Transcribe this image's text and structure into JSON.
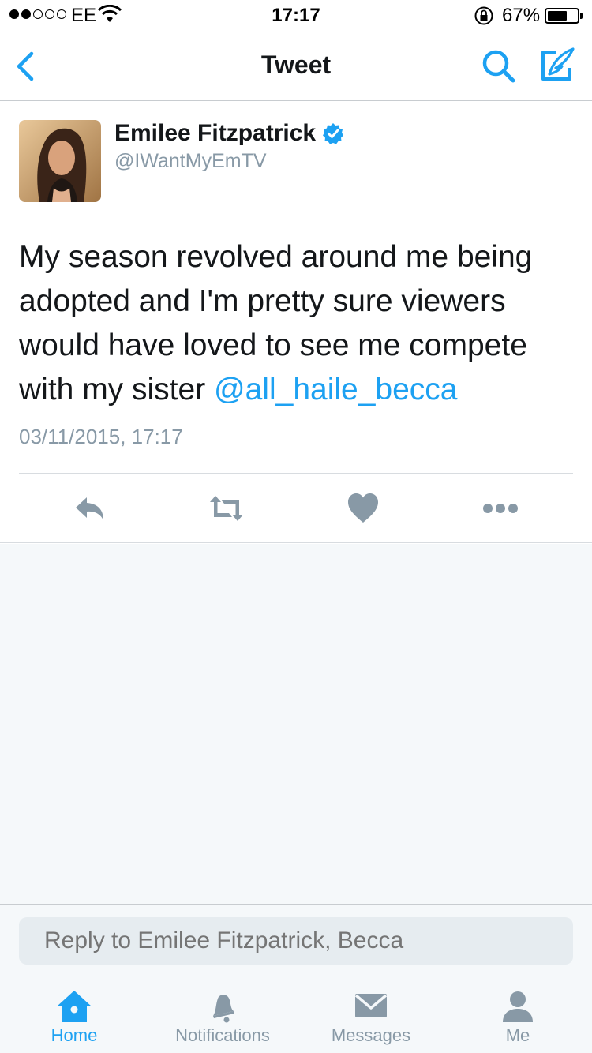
{
  "status_bar": {
    "carrier": "EE",
    "time": "17:17",
    "battery_percent": "67%",
    "battery_level": 0.67
  },
  "nav": {
    "title": "Tweet",
    "back_icon": "chevron-left-icon",
    "search_icon": "search-icon",
    "compose_icon": "compose-icon"
  },
  "tweet": {
    "author_name": "Emilee Fitzpatrick",
    "author_handle": "@IWantMyEmTV",
    "verified": true,
    "text": "My season revolved around me being adopted and I'm pretty sure viewers would have loved to see me compete with my sister ",
    "mention": "@all_haile_becca",
    "timestamp": "03/11/2015, 17:17",
    "actions": [
      "reply-icon",
      "retweet-icon",
      "like-icon",
      "more-icon"
    ]
  },
  "reply": {
    "placeholder": "Reply to Emilee Fitzpatrick, Becca"
  },
  "tabs": [
    {
      "label": "Home",
      "icon": "home-icon",
      "active": true
    },
    {
      "label": "Notifications",
      "icon": "bell-icon",
      "active": false
    },
    {
      "label": "Messages",
      "icon": "envelope-icon",
      "active": false
    },
    {
      "label": "Me",
      "icon": "person-icon",
      "active": false
    }
  ],
  "colors": {
    "accent": "#1da1f2",
    "secondary_text": "#8899a6",
    "action_icon": "#8899a6",
    "background": "#f5f8fa"
  }
}
